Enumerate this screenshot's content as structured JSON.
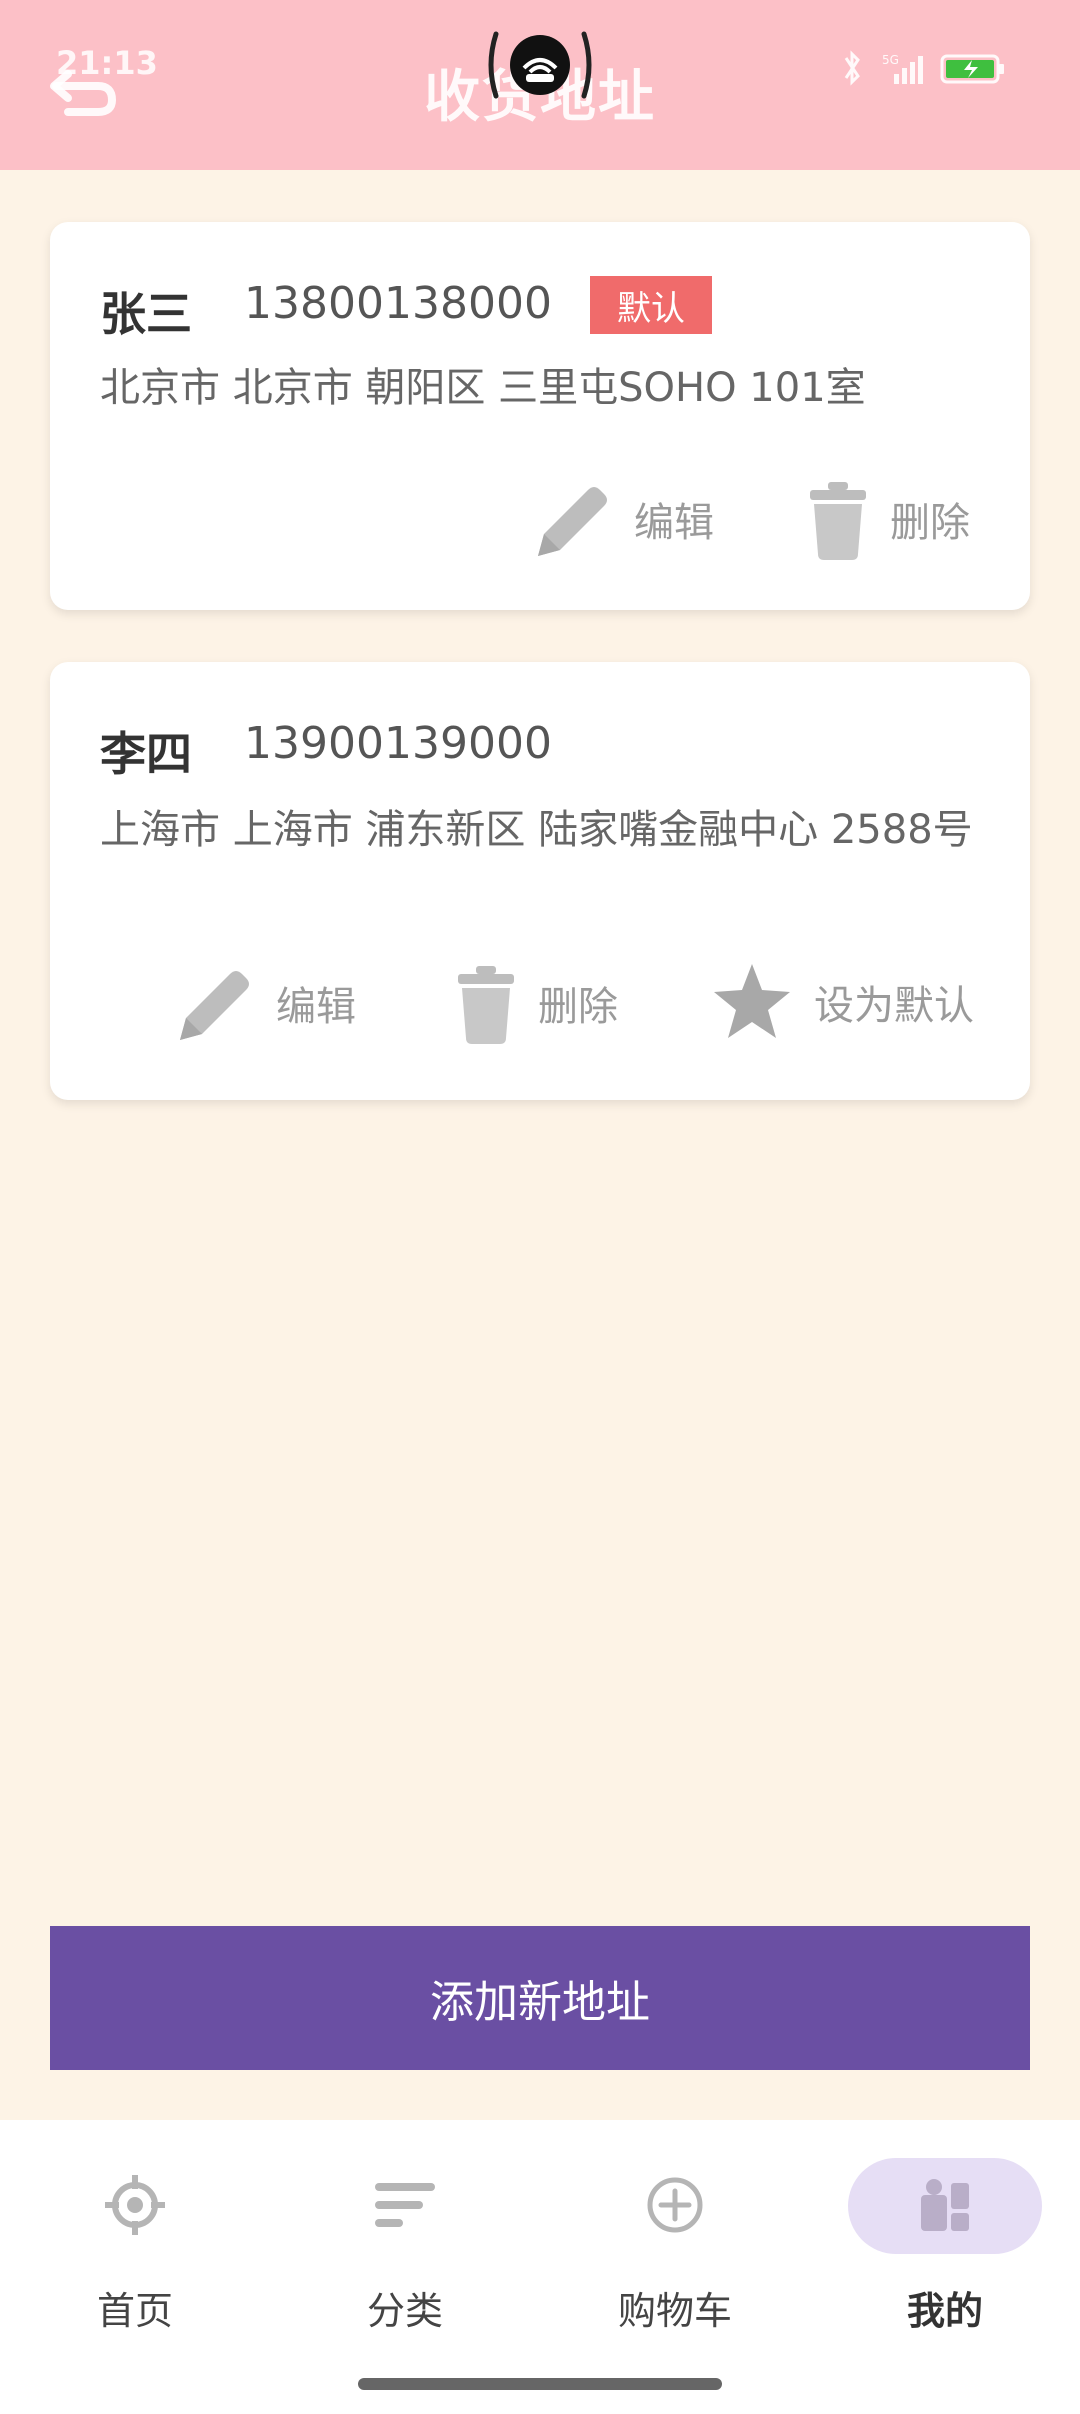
{
  "status_bar": {
    "time": "21:13",
    "network": "5G"
  },
  "header": {
    "title": "收货地址"
  },
  "addresses": [
    {
      "name": "张三",
      "phone": "13800138000",
      "badge": "默认",
      "address": "北京市 北京市 朝阳区 三里屯SOHO 101室",
      "actions": {
        "edit": "编辑",
        "delete": "删除"
      }
    },
    {
      "name": "李四",
      "phone": "13900139000",
      "address": "上海市 上海市 浦东新区 陆家嘴金融中心 2588号",
      "actions": {
        "edit": "编辑",
        "delete": "删除",
        "set_default": "设为默认"
      }
    }
  ],
  "add_button": {
    "label": "添加新地址"
  },
  "bottom_nav": {
    "items": [
      {
        "label": "首页",
        "icon": "compass-icon"
      },
      {
        "label": "分类",
        "icon": "list-icon"
      },
      {
        "label": "购物车",
        "icon": "plus-circle-icon"
      },
      {
        "label": "我的",
        "icon": "profile-icon",
        "active": true
      }
    ]
  },
  "colors": {
    "header_bg": "#fcc0c7",
    "page_bg": "#fdf3e6",
    "badge_bg": "#f06b6b",
    "primary_button": "#6a4fa3",
    "active_nav_pill": "#e6def5"
  }
}
